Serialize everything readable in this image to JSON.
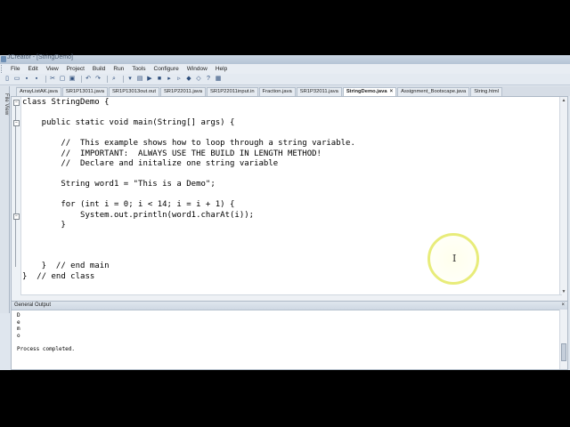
{
  "window": {
    "title": "JCreator - [StringDemo]"
  },
  "menu": [
    "File",
    "Edit",
    "View",
    "Project",
    "Build",
    "Run",
    "Tools",
    "Configure",
    "Window",
    "Help"
  ],
  "tabs": [
    {
      "label": "ArrayListAK.java",
      "active": false
    },
    {
      "label": "SR1P13011.java",
      "active": false
    },
    {
      "label": "SR1P13013out.out",
      "active": false
    },
    {
      "label": "SR1P22011.java",
      "active": false
    },
    {
      "label": "SR1P22011input.in",
      "active": false
    },
    {
      "label": "Fraction.java",
      "active": false
    },
    {
      "label": "SR1P32011.java",
      "active": false
    },
    {
      "label": "StringDemo.java",
      "active": true
    },
    {
      "label": "Assignment_Bootscape.java",
      "active": false
    },
    {
      "label": "String.html",
      "active": false
    }
  ],
  "sidebar": {
    "label": "File View"
  },
  "editor": {
    "code": [
      "class StringDemo {",
      "",
      "    public static void main(String[] args) {",
      "",
      "        //  This example shows how to loop through a string variable.",
      "        //  IMPORTANT:  ALWAYS USE THE BUILD IN LENGTH METHOD!",
      "        //  Declare and initalize one string variable",
      "",
      "        String word1 = \"This is a Demo\";",
      "",
      "        for (int i = 0; i < 14; i = i + 1) {",
      "            System.out.println(word1.charAt(i));",
      "        }",
      "",
      "",
      "",
      "    }  // end main",
      "}  // end class"
    ]
  },
  "output": {
    "title": "General Output",
    "lines": [
      "D",
      "e",
      "m",
      "o",
      "",
      "Process completed."
    ]
  }
}
